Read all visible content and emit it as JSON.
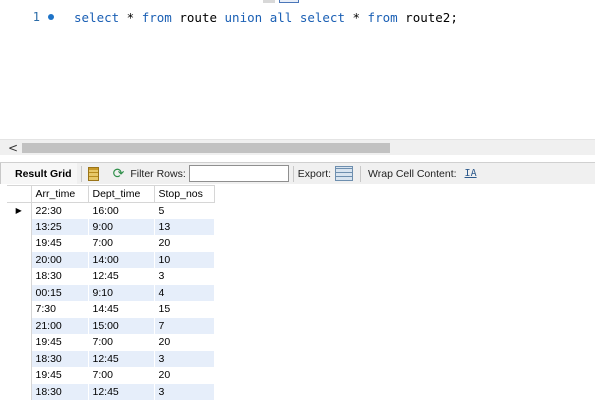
{
  "editor": {
    "line_number": "1",
    "code_tokens": [
      {
        "text": "select",
        "kw": true
      },
      {
        "text": " * ",
        "kw": false
      },
      {
        "text": "from",
        "kw": true
      },
      {
        "text": " route ",
        "kw": false
      },
      {
        "text": "union",
        "kw": true
      },
      {
        "text": " ",
        "kw": false
      },
      {
        "text": "all",
        "kw": true
      },
      {
        "text": " ",
        "kw": false
      },
      {
        "text": "select",
        "kw": true
      },
      {
        "text": " * ",
        "kw": false
      },
      {
        "text": "from",
        "kw": true
      },
      {
        "text": " route2;",
        "kw": false
      }
    ]
  },
  "scrollbar": {
    "left_arrow": "<"
  },
  "toolbar": {
    "result_grid_label": "Result Grid",
    "filter_label": "Filter Rows:",
    "filter_value": "",
    "export_label": "Export:",
    "wrap_label": "Wrap Cell Content:",
    "wrap_icon": "IA"
  },
  "grid": {
    "columns": [
      "Arr_time",
      "Dept_time",
      "Stop_nos"
    ],
    "row_marker": "▶",
    "rows": [
      [
        "22:30",
        "16:00",
        "5"
      ],
      [
        "13:25",
        "9:00",
        "13"
      ],
      [
        "19:45",
        "7:00",
        "20"
      ],
      [
        "20:00",
        "14:00",
        "10"
      ],
      [
        "18:30",
        "12:45",
        "3"
      ],
      [
        "00:15",
        "9:10",
        "4"
      ],
      [
        "7:30",
        "14:45",
        "15"
      ],
      [
        "21:00",
        "15:00",
        "7"
      ],
      [
        "19:45",
        "7:00",
        "20"
      ],
      [
        "18:30",
        "12:45",
        "3"
      ],
      [
        "19:45",
        "7:00",
        "20"
      ],
      [
        "18:30",
        "12:45",
        "3"
      ]
    ]
  }
}
